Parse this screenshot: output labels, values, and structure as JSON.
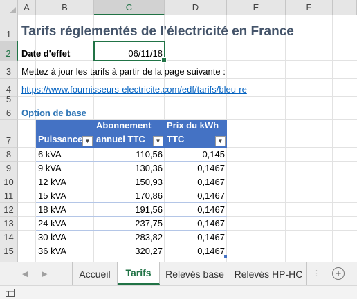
{
  "columns": [
    "A",
    "B",
    "C",
    "D",
    "E",
    "F"
  ],
  "rows": [
    "1",
    "2",
    "3",
    "4",
    "5",
    "6",
    "7",
    "8",
    "9",
    "10",
    "11",
    "12",
    "13",
    "14",
    "15"
  ],
  "cells": {
    "title": "Tarifs réglementés de l'électricité en France",
    "date_label": "Date d'effet",
    "date_value": "06/11/18",
    "instruction": "Mettez à jour les tarifs à partir de la page suivante :",
    "link": "https://www.fournisseurs-electricite.com/edf/tarifs/bleu-re",
    "section": "Option de base"
  },
  "table": {
    "headers": [
      {
        "line1": "",
        "line2": "Puissance"
      },
      {
        "line1": "Abonnement",
        "line2": "annuel TTC"
      },
      {
        "line1": "Prix du kWh",
        "line2": "TTC"
      }
    ],
    "rows": [
      [
        "6 kVA",
        "110,56",
        "0,145"
      ],
      [
        "9 kVA",
        "130,36",
        "0,1467"
      ],
      [
        "12 kVA",
        "150,93",
        "0,1467"
      ],
      [
        "15 kVA",
        "170,86",
        "0,1467"
      ],
      [
        "18 kVA",
        "191,56",
        "0,1467"
      ],
      [
        "24 kVA",
        "237,75",
        "0,1467"
      ],
      [
        "30 kVA",
        "283,82",
        "0,1467"
      ],
      [
        "36 kVA",
        "320,27",
        "0,1467"
      ]
    ]
  },
  "tabs": [
    "Accueil",
    "Tarifs",
    "Relevés base",
    "Relevés HP-HC"
  ],
  "active_tab": "Tarifs",
  "colors": {
    "accent": "#217346",
    "table_header": "#4472c4",
    "title": "#44546a",
    "link": "#0563c1",
    "section": "#2e75b6"
  }
}
